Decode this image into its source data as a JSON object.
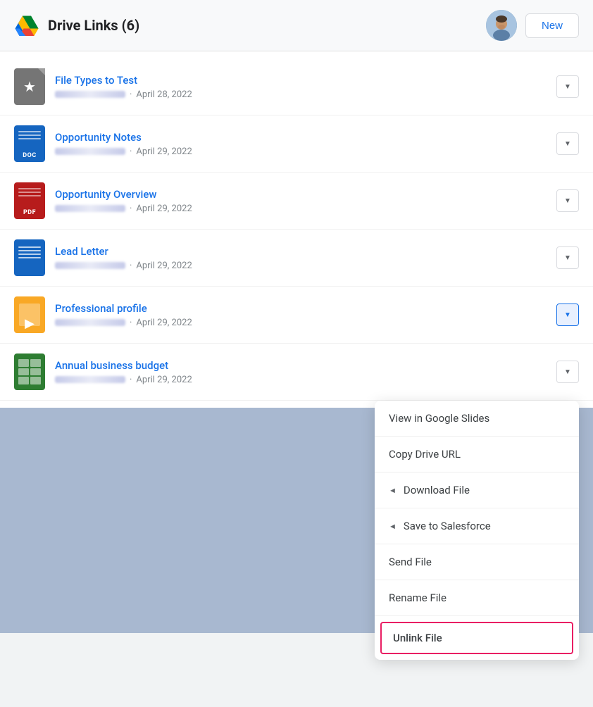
{
  "header": {
    "title": "Drive Links (6)",
    "new_button_label": "New"
  },
  "files": [
    {
      "id": "file-types",
      "name": "File Types to Test",
      "date": "April 28, 2022",
      "icon_type": "star"
    },
    {
      "id": "opportunity-notes",
      "name": "Opportunity Notes",
      "date": "April 29, 2022",
      "icon_type": "doc"
    },
    {
      "id": "opportunity-overview",
      "name": "Opportunity Overview",
      "date": "April 29, 2022",
      "icon_type": "pdf"
    },
    {
      "id": "lead-letter",
      "name": "Lead Letter",
      "date": "April 29, 2022",
      "icon_type": "gdoc"
    },
    {
      "id": "professional-profile",
      "name": "Professional profile",
      "date": "April 29, 2022",
      "icon_type": "slides"
    },
    {
      "id": "annual-budget",
      "name": "Annual business budget",
      "date": "April 29, 2022",
      "icon_type": "sheets"
    }
  ],
  "dropdown_menu": {
    "items": [
      {
        "id": "view-slides",
        "label": "View in Google Slides",
        "has_arrow": false
      },
      {
        "id": "copy-url",
        "label": "Copy Drive URL",
        "has_arrow": false
      },
      {
        "id": "download-file",
        "label": "Download File",
        "has_arrow": true
      },
      {
        "id": "save-salesforce",
        "label": "Save to Salesforce",
        "has_arrow": true
      },
      {
        "id": "send-file",
        "label": "Send File",
        "has_arrow": false
      },
      {
        "id": "rename-file",
        "label": "Rename File",
        "has_arrow": false
      },
      {
        "id": "unlink-file",
        "label": "Unlink File",
        "has_arrow": false
      }
    ]
  },
  "colors": {
    "accent_blue": "#1a73e8",
    "unlink_border": "#e91e63"
  }
}
